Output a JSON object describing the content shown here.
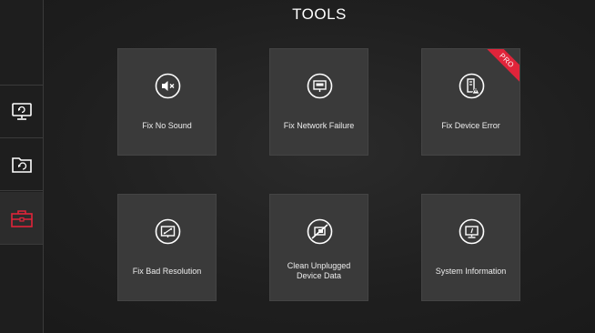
{
  "header": {
    "title": "TOOLS"
  },
  "sidebar": {
    "items": [
      {
        "name": "monitor",
        "icon": "monitor-refresh-icon",
        "active": false
      },
      {
        "name": "restore",
        "icon": "folder-restore-icon",
        "active": false
      },
      {
        "name": "tools",
        "icon": "toolbox-icon",
        "active": true
      }
    ]
  },
  "tools": [
    {
      "label": "Fix No Sound",
      "icon": "speaker-mute-icon"
    },
    {
      "label": "Fix Network Failure",
      "icon": "network-icon"
    },
    {
      "label": "Fix Device Error",
      "icon": "device-warning-icon",
      "badge": "PRO"
    },
    {
      "label": "Fix Bad Resolution",
      "icon": "resolution-icon"
    },
    {
      "label": "Clean Unplugged Device Data",
      "icon": "unplugged-device-icon"
    },
    {
      "label": "System Information",
      "icon": "system-info-icon"
    }
  ],
  "colors": {
    "background": "#1f1f1f",
    "tile": "#3a3a3a",
    "accent": "#e0243a",
    "text": "#ececec"
  }
}
